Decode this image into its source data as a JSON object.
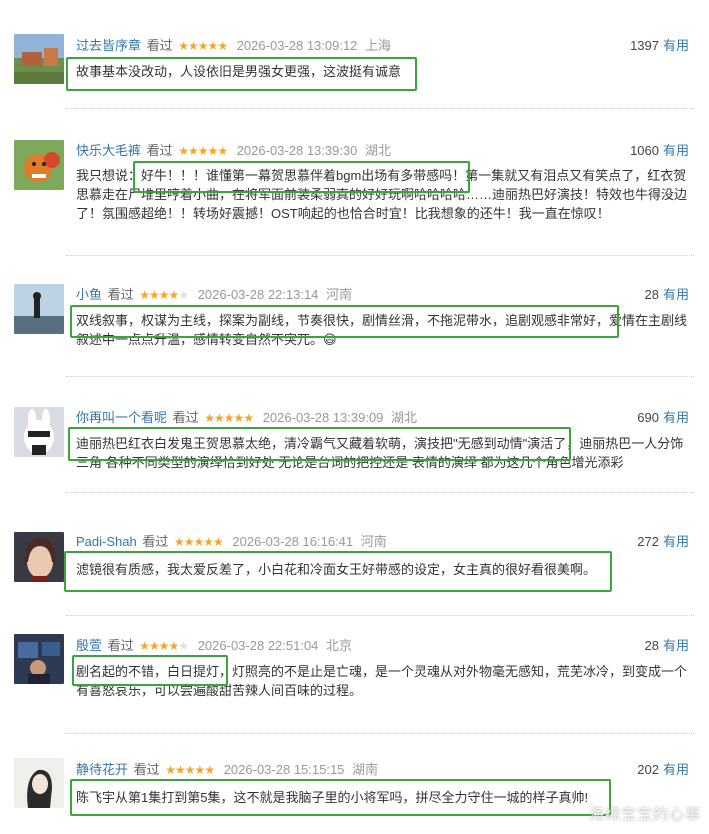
{
  "useful_label": "有用",
  "seen_label": "看过",
  "comments": [
    {
      "user": "过去皆序章",
      "stars": 5,
      "time": "2026-03-28 13:09:12",
      "location": "上海",
      "votes": "1397",
      "text": "故事基本没改动，人设依旧是男强女更强，这波挺有诚意"
    },
    {
      "user": "快乐大毛裤",
      "stars": 5,
      "time": "2026-03-28 13:39:30",
      "location": "湖北",
      "votes": "1060",
      "text": "我只想说：好牛！！！谁懂第一幕贺思慕伴着bgm出场有多带感吗！第一集就又有泪点又有笑点了，红衣贺思慕走在尸堆里哼着小曲，在将军面前装柔弱真的好好玩啊哈哈哈哈……迪丽热巴好演技！特效也牛得没边了！氛围感超绝！！转场好震撼！OST响起的也恰合时宜！比我想象的还牛！我一直在惊叹！"
    },
    {
      "user": "小鱼",
      "stars": 4,
      "time": "2026-03-28 22:13:14",
      "location": "河南",
      "votes": "28",
      "text": "双线叙事，权谋为主线，探案为副线，节奏很快，剧情丝滑，不拖泥带水，追剧观感非常好，爱情在主剧线叙述中一点点升温，感情转变自然不突兀。😄"
    },
    {
      "user": "你再叫一个看呢",
      "stars": 5,
      "time": "2026-03-28 13:39:09",
      "location": "湖北",
      "votes": "690",
      "text": "迪丽热巴红衣白发鬼王贺思慕太绝，清冷霸气又藏着软萌，演技把\"无感到动情\"演活了，迪丽热巴一人分饰三角 各种不同类型的演绎恰到好处 无论是台词的把控还是 表情的演绎 都为这几个角色增光添彩"
    },
    {
      "user": "Padi-Shah",
      "stars": 5,
      "time": "2026-03-28 16:16:41",
      "location": "河南",
      "votes": "272",
      "text": "滤镜很有质感，我太爱反差了，小白花和冷面女王好带感的设定，女主真的很好看很美啊。"
    },
    {
      "user": "殷萱",
      "stars": 4,
      "time": "2026-03-28 22:51:04",
      "location": "北京",
      "votes": "28",
      "text": "剧名起的不错，白日提灯，灯照亮的不是止是亡魂，是一个灵魂从对外物毫无感知，荒芜冰冷，到变成一个有喜怒哀乐，可以尝遍酸甜苦辣人间百味的过程。"
    },
    {
      "user": "静待花开",
      "stars": 5,
      "time": "2026-03-28 15:15:15",
      "location": "湖南",
      "votes": "202",
      "text": "陈飞宇从第1集打到第5集，这不就是我脑子里的小将军吗，拼尽全力守住一城的样子真帅!"
    }
  ],
  "watermark": "海绵宝宝的心事",
  "colors": {
    "link": "#3377aa",
    "star": "#f5a623",
    "highlight": "#3aa53a",
    "meta": "#999999"
  }
}
